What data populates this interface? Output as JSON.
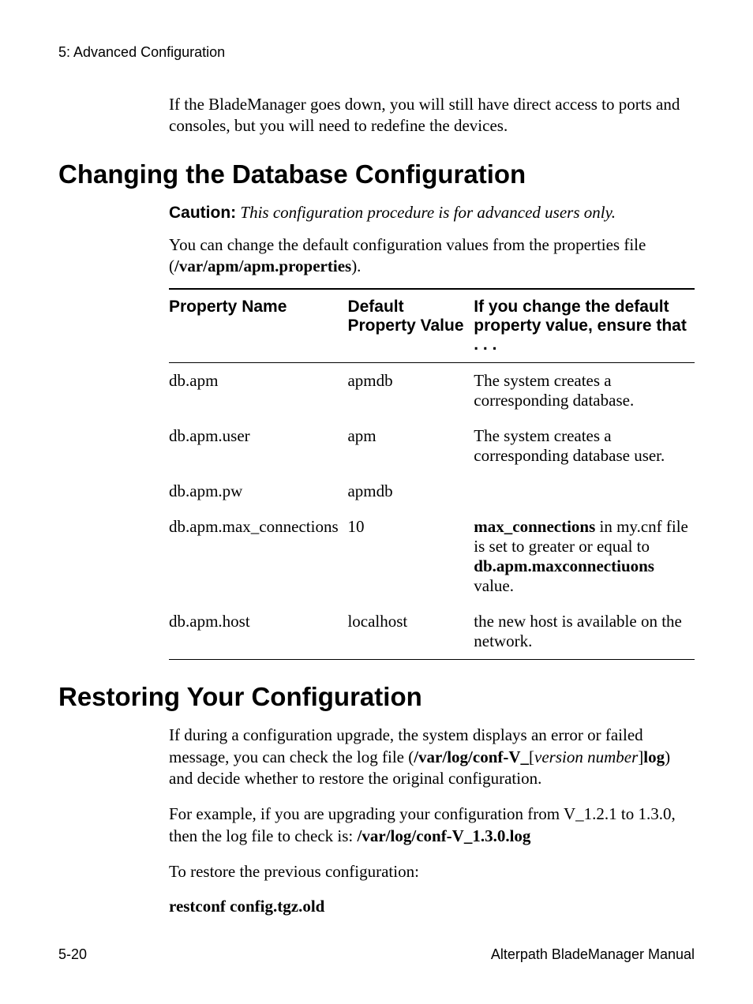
{
  "header": {
    "running": "5: Advanced Configuration"
  },
  "intro_para": "If the BladeManager goes down, you will still have direct access to ports and consoles, but you will need to redefine the devices.",
  "section1": {
    "title": "Changing the Database Configuration",
    "caution_label": "Caution:",
    "caution_text": "This configuration procedure is for advanced users only.",
    "props_prefix": "You can change the default configuration values from the properties file (",
    "props_path": "/var/apm/apm.properties",
    "props_suffix": ").",
    "table": {
      "head": {
        "c1": "Property Name",
        "c2": "Default Property Value",
        "c3": "If you change the default property value, ensure that . . ."
      },
      "rows": [
        {
          "name": "db.apm",
          "default": "apmdb",
          "note_plain": "The system creates a corresponding database."
        },
        {
          "name": "db.apm.user",
          "default": "apm",
          "note_plain": "The system creates a corresponding database user."
        },
        {
          "name": "db.apm.pw",
          "default": "apmdb",
          "note_plain": ""
        },
        {
          "name": "db.apm.max_connections",
          "default": "10",
          "note_rich": {
            "b1": "max_connections",
            "t1": " in my.cnf file is set to greater or equal to ",
            "b2": "db.apm.maxconnectiuons",
            "t2": " value."
          }
        },
        {
          "name": "db.apm.host",
          "default": "localhost",
          "note_plain": "the new host is available on the network."
        }
      ]
    }
  },
  "section2": {
    "title": "Restoring Your Configuration",
    "p1": {
      "t1": "If during a configuration upgrade, the system displays an error or failed message, you can check the log file (",
      "b1": "/var/log/conf-V_",
      "t2": "[",
      "i1": "version number",
      "t3": "]",
      "b2": "log",
      "t4": ") and decide whether to restore the original configuration."
    },
    "p2": {
      "t1": "For example, if you are upgrading your configuration from V_1.2.1 to 1.3.0, then the log file to check is:  ",
      "b1": "/var/log/conf-V_1.3.0.log"
    },
    "p3": "To restore the previous configuration:",
    "cmd": "restconf config.tgz.old"
  },
  "footer": {
    "page": "5-20",
    "manual": "Alterpath BladeManager Manual"
  }
}
